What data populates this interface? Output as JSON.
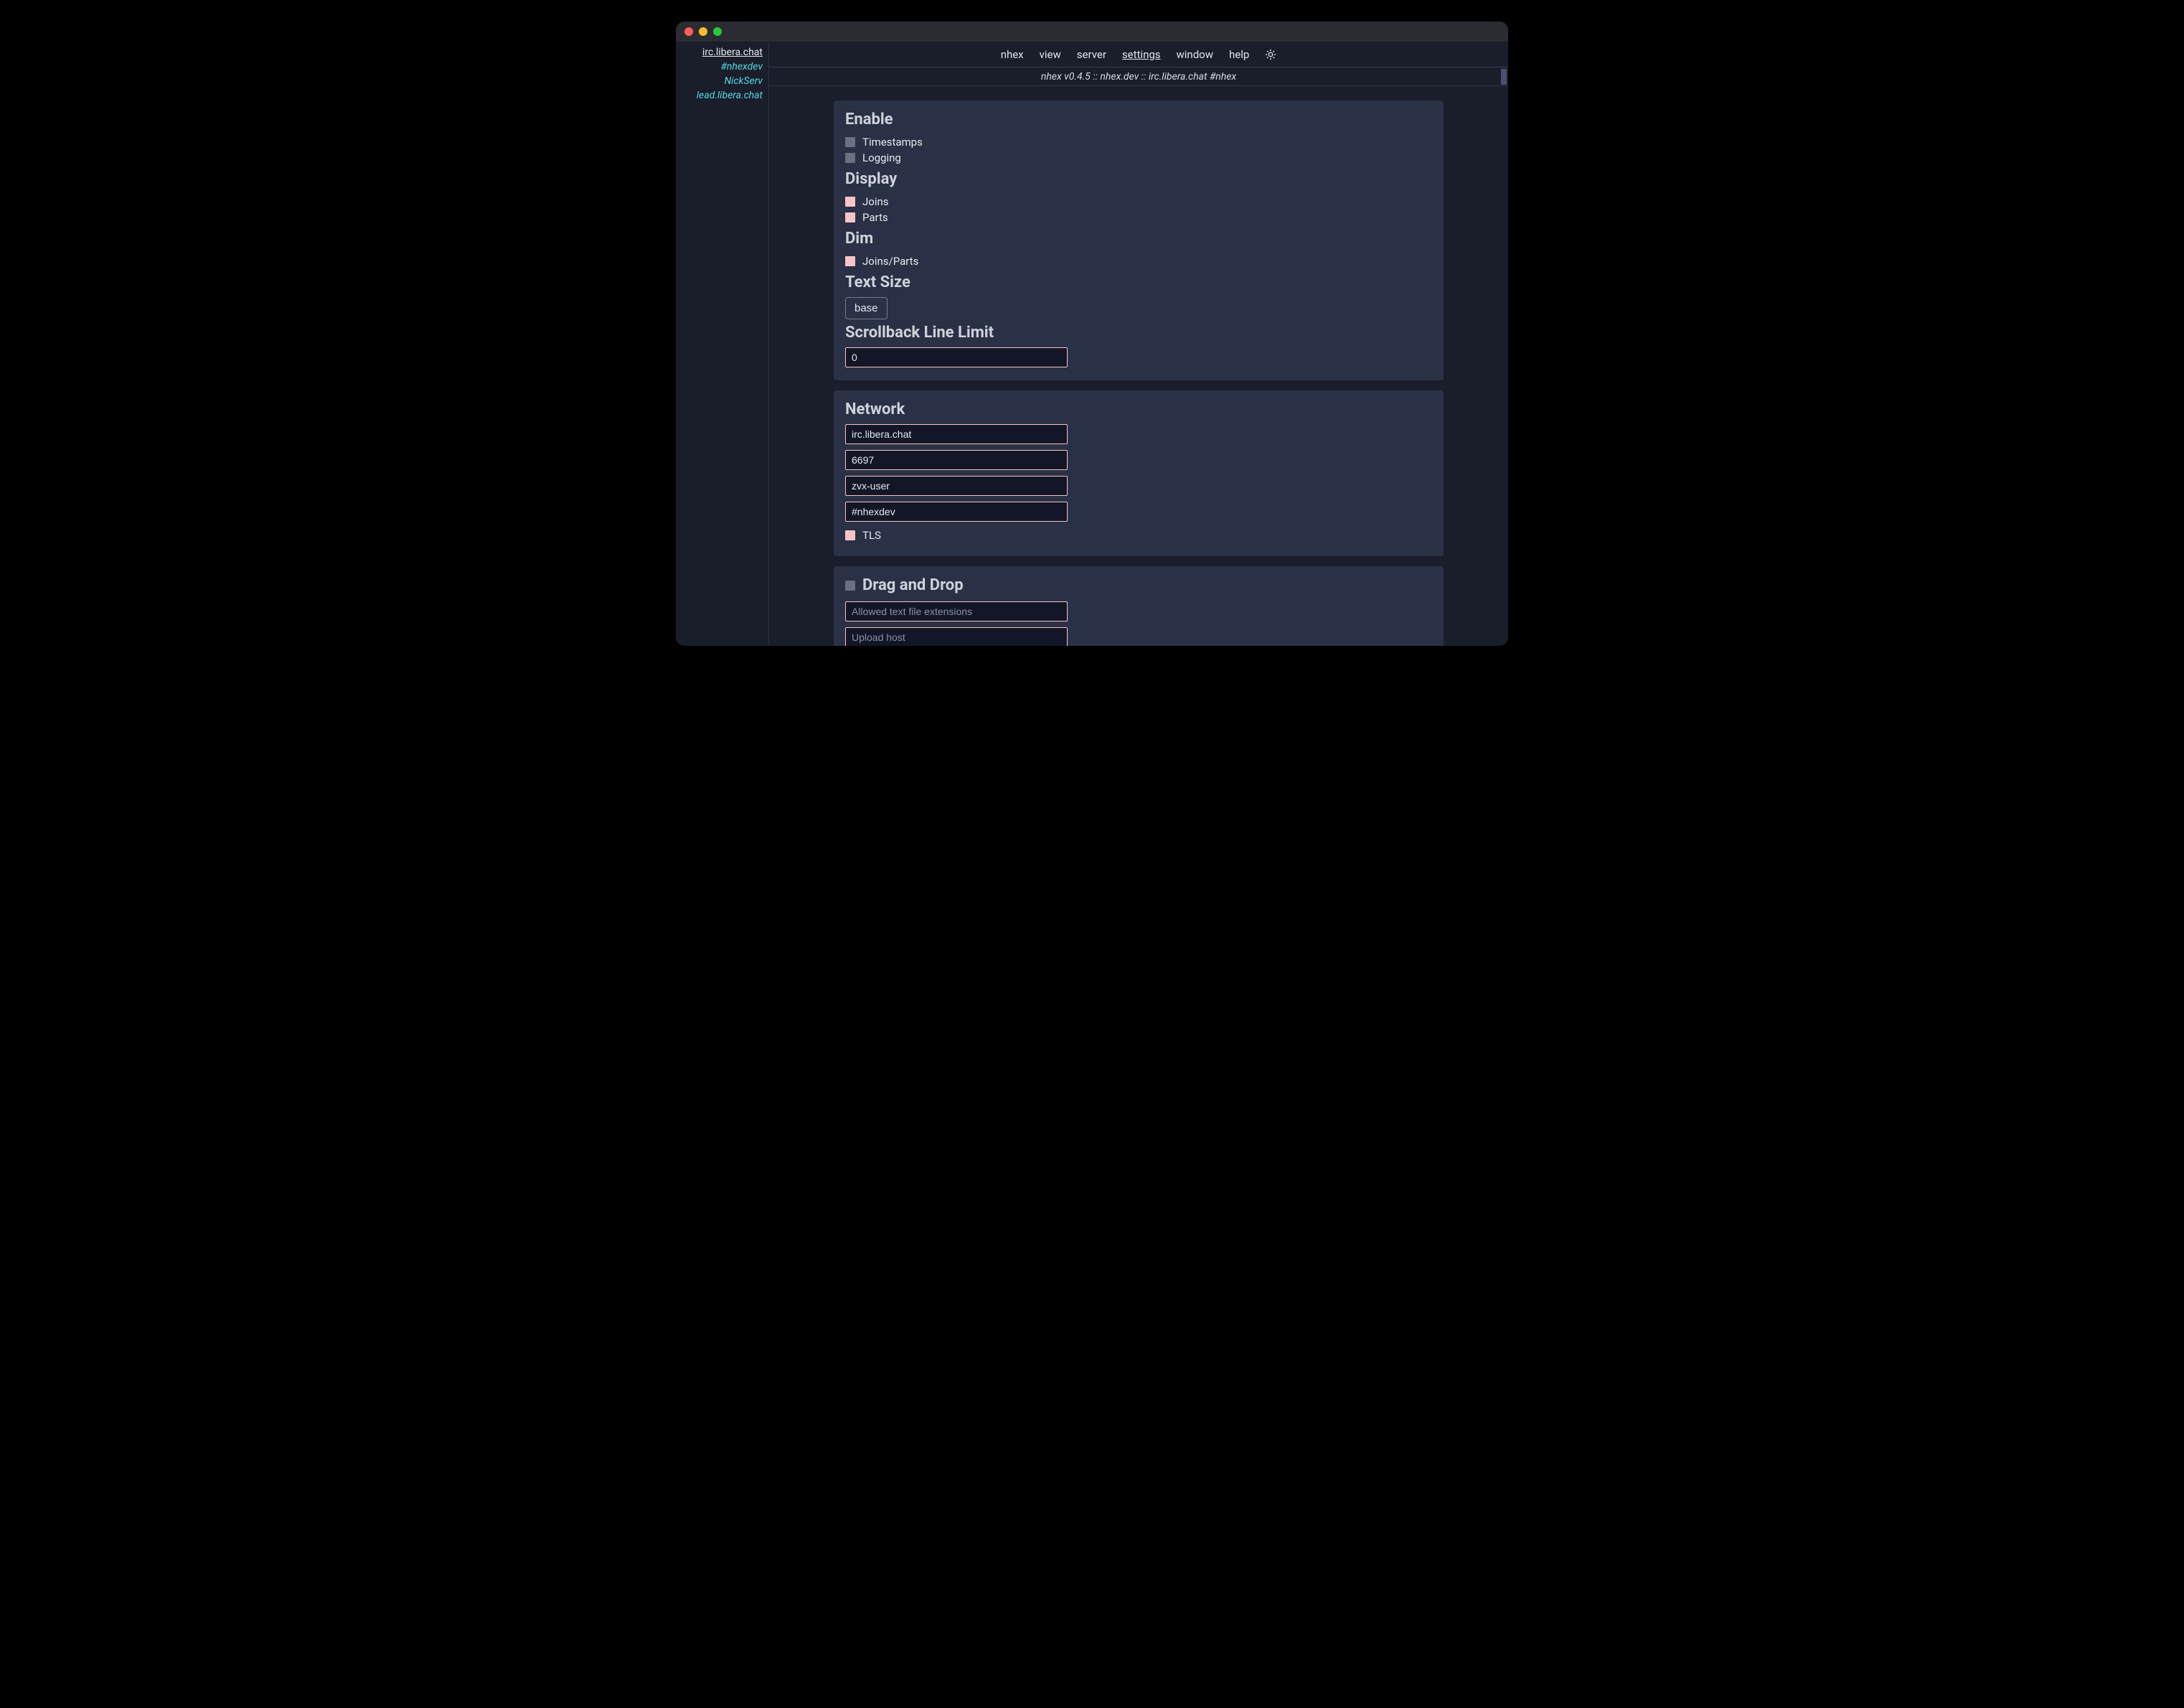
{
  "sidebar": {
    "items": [
      {
        "label": "irc.libera.chat",
        "active": true
      },
      {
        "label": "#nhexdev",
        "active": false
      },
      {
        "label": "NickServ",
        "active": false
      },
      {
        "label": "lead.libera.chat",
        "active": false
      }
    ]
  },
  "menu": {
    "items": [
      {
        "label": "nhex",
        "active": false
      },
      {
        "label": "view",
        "active": false
      },
      {
        "label": "server",
        "active": false
      },
      {
        "label": "settings",
        "active": true
      },
      {
        "label": "window",
        "active": false
      },
      {
        "label": "help",
        "active": false
      }
    ],
    "theme_icon": "sun-icon"
  },
  "statusline": "nhex v0.4.5 :: nhex.dev :: irc.libera.chat #nhex",
  "settings": {
    "enable": {
      "heading": "Enable",
      "timestamps": {
        "label": "Timestamps",
        "checked": false
      },
      "logging": {
        "label": "Logging",
        "checked": false
      }
    },
    "display": {
      "heading": "Display",
      "joins": {
        "label": "Joins",
        "checked": true
      },
      "parts": {
        "label": "Parts",
        "checked": true
      }
    },
    "dim": {
      "heading": "Dim",
      "joins_parts": {
        "label": "Joins/Parts",
        "checked": true
      }
    },
    "text_size": {
      "heading": "Text Size",
      "value": "base"
    },
    "scrollback": {
      "heading": "Scrollback Line Limit",
      "value": "0"
    }
  },
  "network": {
    "heading": "Network",
    "host": "irc.libera.chat",
    "port": "6697",
    "nick": "zvx-user",
    "channels": "#nhexdev",
    "tls": {
      "label": "TLS",
      "checked": true
    }
  },
  "dnd": {
    "heading": "Drag and Drop",
    "enabled": false,
    "ext_placeholder": "Allowed text file extensions",
    "host_placeholder": "Upload host"
  }
}
